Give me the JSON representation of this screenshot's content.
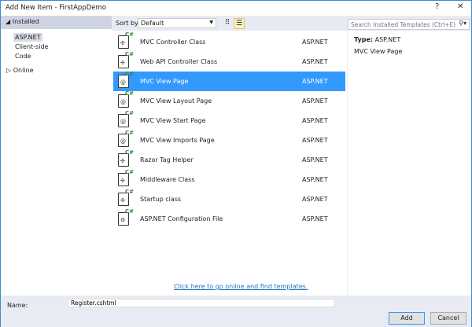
{
  "window": {
    "title": "Add New Item - FirstAppDemo",
    "help": "?",
    "close": "✕"
  },
  "sidebar": {
    "installed": "Installed",
    "items": [
      "ASP.NET",
      "Client-side",
      "Code"
    ],
    "online": "Online"
  },
  "toolbar": {
    "sort_label": "Sort by:",
    "sort_value": "Default",
    "search_placeholder": "Search Installed Templates (Ctrl+E)"
  },
  "templates": [
    {
      "name": "MVC Controller Class",
      "type": "ASP.NET",
      "icon": "controller-icon"
    },
    {
      "name": "Web API Controller Class",
      "type": "ASP.NET",
      "icon": "controller-icon"
    },
    {
      "name": "MVC View Page",
      "type": "ASP.NET",
      "icon": "razor-view-icon",
      "selected": true
    },
    {
      "name": "MVC View Layout Page",
      "type": "ASP.NET",
      "icon": "razor-view-icon"
    },
    {
      "name": "MVC View Start Page",
      "type": "ASP.NET",
      "icon": "razor-view-icon"
    },
    {
      "name": "MVC View Imports Page",
      "type": "ASP.NET",
      "icon": "razor-view-icon"
    },
    {
      "name": "Razor Tag Helper",
      "type": "ASP.NET",
      "icon": "controller-icon"
    },
    {
      "name": "Middleware Class",
      "type": "ASP.NET",
      "icon": "controller-icon"
    },
    {
      "name": "Startup class",
      "type": "ASP.NET",
      "icon": "controller-icon"
    },
    {
      "name": "ASP.NET Configuration File",
      "type": "ASP.NET",
      "icon": "config-file-icon"
    }
  ],
  "online_link": "Click here to go online and find templates.",
  "details": {
    "type_label": "Type:",
    "type_value": "ASP.NET",
    "description": "MVC View Page"
  },
  "footer": {
    "name_label": "Name:",
    "name_value": "Register.cshtml",
    "add": "Add",
    "cancel": "Cancel"
  },
  "colors": {
    "selection": "#3399ff",
    "accent": "#388a34"
  }
}
